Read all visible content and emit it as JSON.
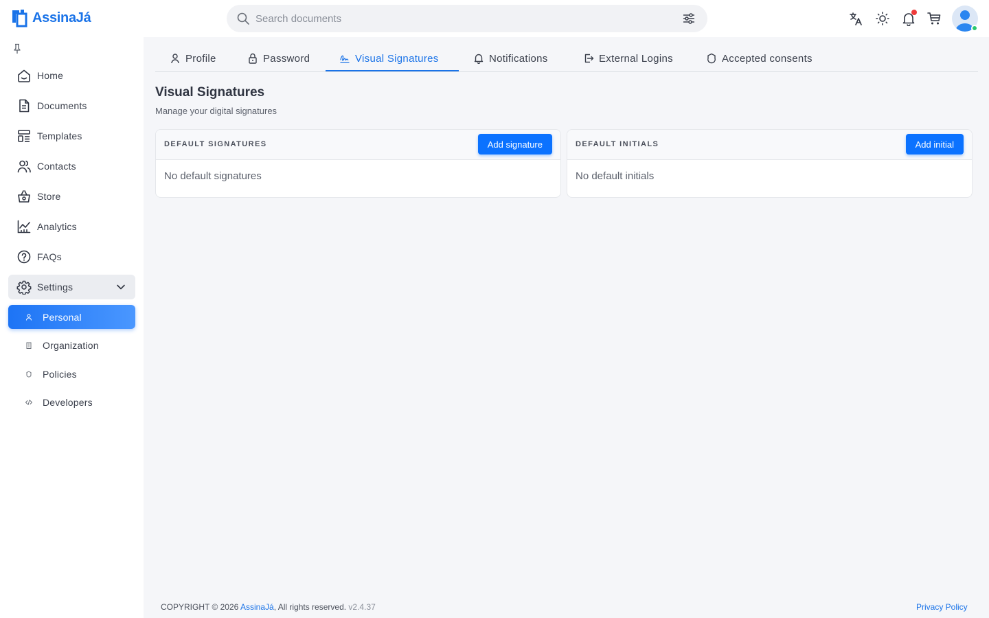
{
  "header": {
    "brand": "AssinaJá",
    "search_placeholder": "Search documents"
  },
  "sidebar": {
    "items": [
      {
        "label": "Home",
        "icon": "home-icon"
      },
      {
        "label": "Documents",
        "icon": "document-icon"
      },
      {
        "label": "Templates",
        "icon": "template-icon"
      },
      {
        "label": "Contacts",
        "icon": "contacts-icon"
      },
      {
        "label": "Store",
        "icon": "basket-icon"
      },
      {
        "label": "Analytics",
        "icon": "analytics-icon"
      },
      {
        "label": "FAQs",
        "icon": "help-icon"
      },
      {
        "label": "Settings",
        "icon": "gear-icon"
      }
    ],
    "settings_sub": [
      {
        "label": "Personal",
        "icon": "user-icon",
        "active": true
      },
      {
        "label": "Organization",
        "icon": "building-icon"
      },
      {
        "label": "Policies",
        "icon": "shield-icon"
      },
      {
        "label": "Developers",
        "icon": "code-icon"
      }
    ]
  },
  "tabs": [
    {
      "label": "Profile",
      "icon": "user-icon"
    },
    {
      "label": "Password",
      "icon": "lock-icon"
    },
    {
      "label": "Visual Signatures",
      "icon": "signature-icon",
      "active": true
    },
    {
      "label": "Notifications",
      "icon": "bell-icon"
    },
    {
      "label": "External Logins",
      "icon": "login-icon"
    },
    {
      "label": "Accepted consents",
      "icon": "shield-icon"
    }
  ],
  "page": {
    "title": "Visual Signatures",
    "subtitle": "Manage your digital signatures"
  },
  "cards": {
    "signatures": {
      "title": "DEFAULT SIGNATURES",
      "button": "Add signature",
      "empty": "No default signatures"
    },
    "initials": {
      "title": "DEFAULT INITIALS",
      "button": "Add initial",
      "empty": "No default initials"
    }
  },
  "footer": {
    "prefix": "COPYRIGHT © 2026 ",
    "brand": "AssinaJá",
    "suffix": ", All rights reserved.",
    "version": "v2.4.37",
    "privacy": "Privacy Policy"
  },
  "colors": {
    "accent": "#1a73e8",
    "button": "#0b72ff",
    "background": "#f5f6f9",
    "notification_dot": "#ee3a3a",
    "online_dot": "#28c76f"
  }
}
